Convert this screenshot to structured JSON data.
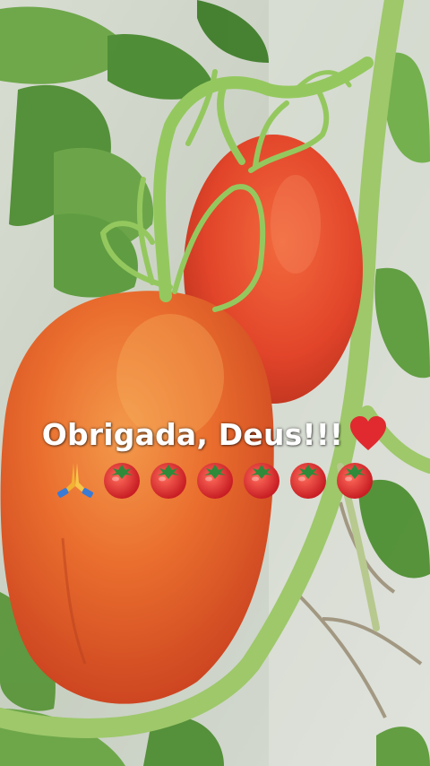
{
  "caption": {
    "text": "Obrigada, Deus!!!",
    "trailing_icon": "red-heart-icon",
    "emoji_row": [
      "praying-hands-icon",
      "tomato-icon",
      "tomato-icon",
      "tomato-icon",
      "tomato-icon",
      "tomato-icon",
      "tomato-icon"
    ]
  },
  "colors": {
    "tomato": "#e2502a",
    "tomato_highlight": "#f0833f",
    "stem_green": "#9ec86a",
    "leaf_green": "#5f9a3c",
    "background": "#cfd6cb",
    "heart_red": "#e02a2f"
  }
}
